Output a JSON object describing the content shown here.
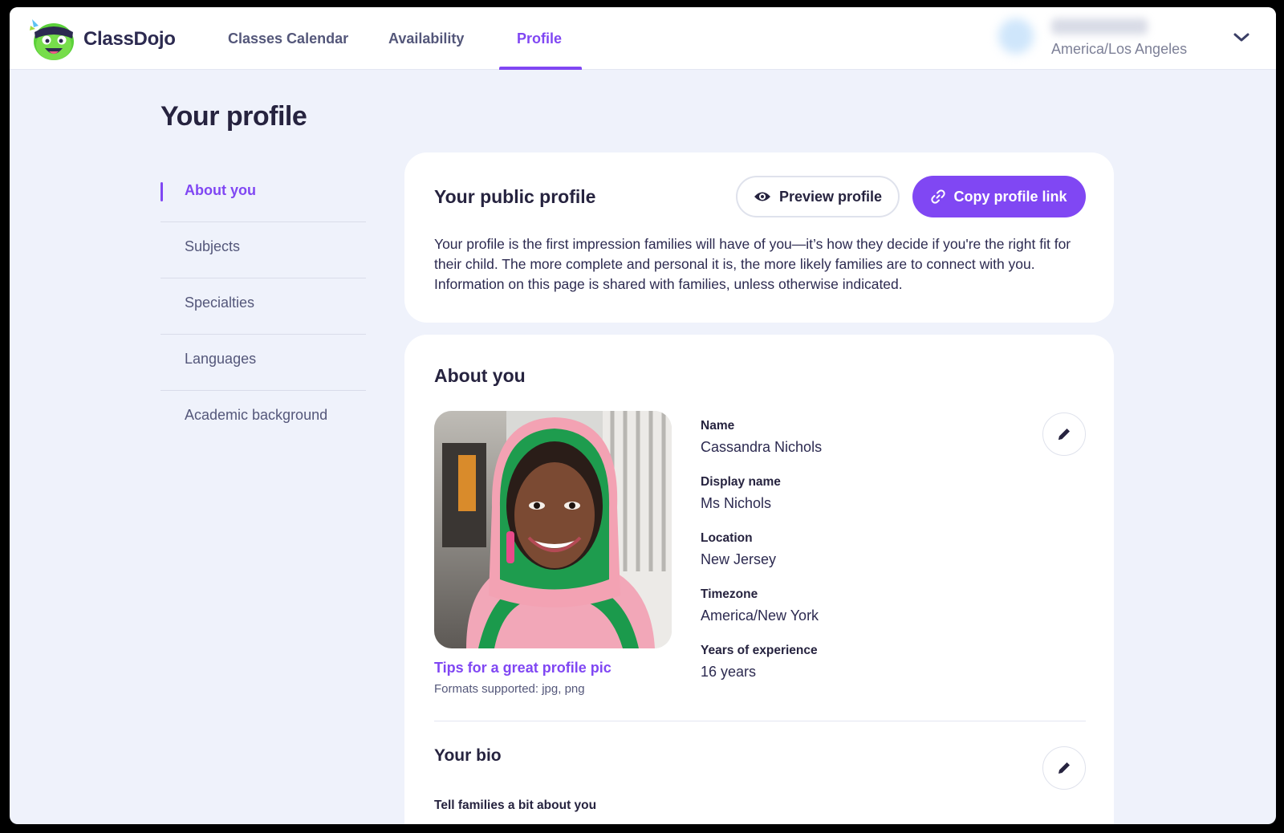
{
  "app": {
    "brand": "ClassDojo"
  },
  "nav": {
    "items": [
      {
        "label": "Classes Calendar"
      },
      {
        "label": "Availability"
      },
      {
        "label": "Profile",
        "active": true
      }
    ]
  },
  "user": {
    "timezone": "America/Los Angeles"
  },
  "page": {
    "title": "Your profile"
  },
  "sidebar": {
    "items": [
      {
        "label": "About you",
        "active": true
      },
      {
        "label": "Subjects"
      },
      {
        "label": "Specialties"
      },
      {
        "label": "Languages"
      },
      {
        "label": "Academic background"
      }
    ]
  },
  "public_profile": {
    "title": "Your public profile",
    "preview_label": "Preview profile",
    "copy_label": "Copy profile link",
    "description": "Your profile is the first impression families will have of you—it’s how they decide if you're the right fit for their child. The more complete and personal it is, the more likely families are to connect with you. Information on this page is shared with families, unless otherwise indicated."
  },
  "about": {
    "title": "About you",
    "photo_tips": "Tips for a great profile pic",
    "formats": "Formats supported: jpg, png",
    "fields": [
      {
        "label": "Name",
        "value": "Cassandra Nichols"
      },
      {
        "label": "Display name",
        "value": "Ms Nichols"
      },
      {
        "label": "Location",
        "value": "New Jersey"
      },
      {
        "label": "Timezone",
        "value": "America/New York"
      },
      {
        "label": "Years of experience",
        "value": "16 years"
      }
    ]
  },
  "bio": {
    "title": "Your bio",
    "subtitle": "Tell families a bit about you"
  },
  "colors": {
    "accent": "#8047f3",
    "page_bg": "#eff2fb",
    "text_dark": "#26233f",
    "text_muted": "#54577a"
  },
  "icons": [
    "classdojo-logo-icon",
    "chevron-down-icon",
    "eye-icon",
    "link-icon",
    "camera-icon",
    "pencil-icon"
  ]
}
